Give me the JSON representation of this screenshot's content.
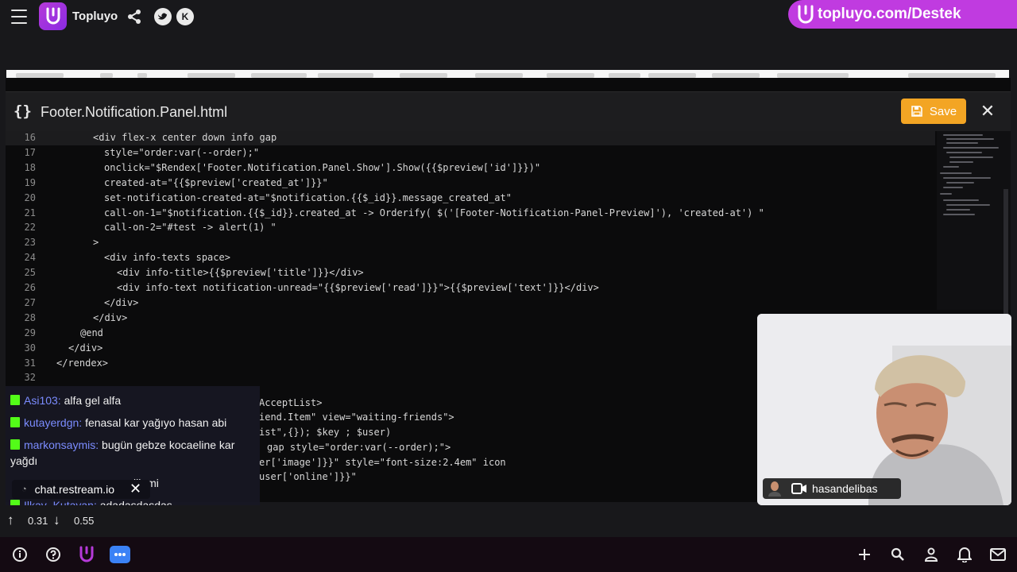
{
  "topbar": {
    "brand": "Topluyo",
    "icons": [
      "hamburger-icon",
      "topluyo-logo",
      "share-icon",
      "twitter-icon",
      "kick-icon"
    ],
    "kick_letter": "K",
    "promo_text": "topluyo.com/Destek"
  },
  "editor": {
    "file_icon": "{}",
    "title": "Footer.Notification.Panel.html",
    "save_label": "Save",
    "close_label": "✕",
    "lines": [
      {
        "n": "16",
        "text": "<div flex-x center down info gap",
        "indent": 117
      },
      {
        "n": "17",
        "text": "style=\"order:var(--order);\"",
        "indent": 131
      },
      {
        "n": "18",
        "text": "onclick=\"$Rendex['Footer.Notification.Panel.Show'].Show({{$preview['id']}})\"",
        "indent": 131
      },
      {
        "n": "19",
        "text": "created-at=\"{{$preview['created_at']}}\"",
        "indent": 131
      },
      {
        "n": "20",
        "text": "set-notification-created-at=\"$notification.{{$_id}}.message_created_at\"",
        "indent": 131
      },
      {
        "n": "21",
        "text": "call-on-1=\"$notification.{{$_id}}.created_at -> Orderify( $('[Footer-Notification-Panel-Preview]'), 'created-at') \"",
        "indent": 131
      },
      {
        "n": "22",
        "text": "call-on-2=\"#test -> alert(1) \"",
        "indent": 131
      },
      {
        "n": "23",
        "text": ">",
        "indent": 117
      },
      {
        "n": "24",
        "text": "<div info-texts space>",
        "indent": 131
      },
      {
        "n": "25",
        "text": "<div info-title>{{$preview['title']}}</div>",
        "indent": 147
      },
      {
        "n": "26",
        "text": "<div info-text notification-unread=\"{{$preview['read']}}\">{{$preview['text']}}</div>",
        "indent": 147
      },
      {
        "n": "27",
        "text": "</div>",
        "indent": 131
      },
      {
        "n": "28",
        "text": "</div>",
        "indent": 117
      },
      {
        "n": "29",
        "text": "@end",
        "indent": 101
      },
      {
        "n": "30",
        "text": "</div>",
        "indent": 86
      },
      {
        "n": "31",
        "text": "</rendex>",
        "indent": 71
      },
      {
        "n": "32",
        "text": "",
        "indent": 71
      }
    ],
    "partial_lines": [
      "AcceptList>",
      "iend.Item\" view=\"waiting-friends\">",
      "ist\",{}); $key ; $user)",
      "gap style=\"order:var(--order);\">",
      "er['image']}}\" style=\"font-size:2.4em\" icon",
      "user['online']}}\""
    ]
  },
  "chat": {
    "messages": [
      {
        "user": "Asi103:",
        "text": "alfa gel alfa"
      },
      {
        "user": "kutayerdgn:",
        "text": "fenasal kar yağıyo hasan abi"
      },
      {
        "user": "markonsaymis:",
        "text": "bugün gebze kocaeline kar yağdı"
      },
      {
        "user": "",
        "text": "lik mi"
      },
      {
        "user": "Ilkay_Kutayan:",
        "text": "adadasdasdas"
      }
    ],
    "pill_label": "chat.restream.io",
    "pill_close": "✕"
  },
  "webcam": {
    "label": "hasandelibas"
  },
  "status": {
    "up_value": "0.31",
    "down_value": "0.55"
  },
  "bottombar": {
    "icons": [
      "info-icon",
      "help-icon",
      "topluyo-icon",
      "chat-icon",
      "plus-icon",
      "search-icon",
      "user-icon",
      "bell-icon",
      "mail-icon"
    ]
  }
}
